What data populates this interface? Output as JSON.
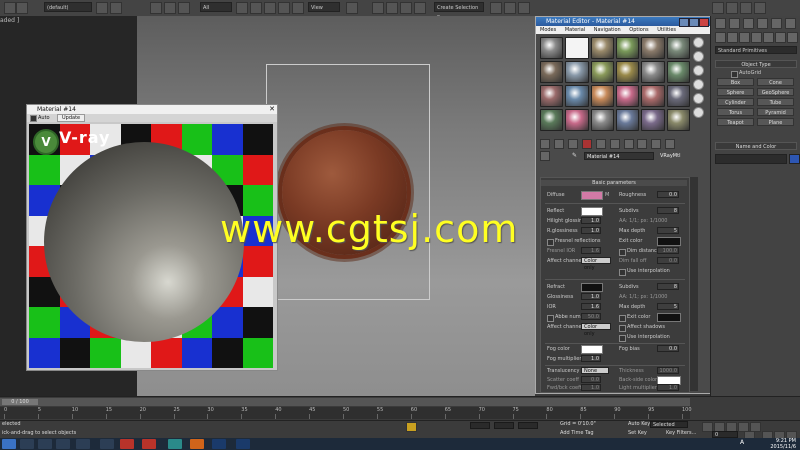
{
  "toolbar": {
    "undo_drop": "(default)",
    "filter_drop": "All",
    "view_drop": "View",
    "selection_set": "Create Selection Se"
  },
  "left_panel": {
    "label": "aded ]"
  },
  "watermark": "www.cgtsj.com",
  "preview_window": {
    "title": "Material #14",
    "auto_label": "Auto",
    "update_label": "Update",
    "logo_text": "V-ray",
    "close_glyph": "✕"
  },
  "material_editor": {
    "title": "Material Editor - Material #14",
    "menu": [
      "Modes",
      "Material",
      "Navigation",
      "Options",
      "Utilities"
    ],
    "material_name": "Material #14",
    "material_type": "VRayMtl",
    "rollout_title": "Basic parameters",
    "params": {
      "diffuse_label": "Diffuse",
      "roughness_label": "Roughness",
      "roughness_value": "0.0",
      "reflect_label": "Reflect",
      "subdivs_label": "Subdivs",
      "subdivs_value": "8",
      "hilight_label": "Hilight glossiness",
      "hilight_value": "1.0",
      "aa_label": "AA: 1/1; px: 1/1000",
      "rglossiness_label": "R.glossiness",
      "rglossiness_value": "1.0",
      "max_depth_label": "Max depth",
      "max_depth_value": "5",
      "fresnel_label": "Fresnel reflections",
      "exit_color_label": "Exit color",
      "fresnel_ior_label": "Fresnel IOR",
      "fresnel_ior_value": "1.6",
      "dim_distance_label": "Dim distance",
      "dim_distance_value": "100.0",
      "affect_channels_label": "Affect channels",
      "affect_channels_value": "Color only",
      "dim_falloff_label": "Dim fall off",
      "dim_falloff_value": "0.0",
      "use_interp_label": "Use interpolation",
      "refract_label": "Refract",
      "refract_subdivs_label": "Subdivs",
      "refract_subdivs_value": "8",
      "glossiness_label": "Glossiness",
      "glossiness_value": "1.0",
      "refract_aa_label": "AA: 1/1; px: 1/1000",
      "ior_label": "IOR",
      "ior_value": "1.6",
      "refract_maxdepth_label": "Max depth",
      "refract_maxdepth_value": "5",
      "abbe_label": "Abbe number",
      "abbe_value": "50.0",
      "refract_exit_label": "Exit color",
      "refract_affect_label": "Affect channels",
      "refract_affect_value": "Color only",
      "affect_shadows_label": "Affect shadows",
      "refract_use_interp_label": "Use interpolation",
      "fog_color_label": "Fog color",
      "fog_bias_label": "Fog bias",
      "fog_bias_value": "0.0",
      "fog_mult_label": "Fog multiplier",
      "fog_mult_value": "1.0",
      "translucency_label": "Translucency",
      "translucency_value": "None",
      "thickness_label": "Thickness",
      "thickness_value": "1000.0",
      "scatter_label": "Scatter coeff",
      "scatter_value": "0.0",
      "backside_label": "Back-side color",
      "fwdbck_label": "Fwd/bck coeff",
      "fwdbck_value": "1.0",
      "light_mult_label": "Light multiplier",
      "light_mult_value": "1.0"
    }
  },
  "command_panel": {
    "dropdown": "Standard Primitives",
    "object_type": "Object Type",
    "autogrid": "AutoGrid",
    "buttons": [
      "Box",
      "Cone",
      "Sphere",
      "GeoSphere",
      "Cylinder",
      "Tube",
      "Torus",
      "Pyramid",
      "Teapot",
      "Plane"
    ],
    "name_and_color": "Name and Color"
  },
  "timeline": {
    "frame_counter": "0 / 100",
    "ticks": [
      "0",
      "5",
      "10",
      "15",
      "20",
      "25",
      "30",
      "35",
      "40",
      "45",
      "50",
      "55",
      "60",
      "65",
      "70",
      "75",
      "80",
      "85",
      "90",
      "95",
      "100"
    ]
  },
  "statusbar": {
    "selected": "elected",
    "prompt": "ick-and-drag to select objects",
    "grid": "Grid = 0'10.0\"",
    "add_time_tag": "Add Time Tag",
    "auto_key": "Auto Key",
    "selected_drop": "Selected",
    "set_key": "Set Key",
    "key_filters": "Key Filters...",
    "frame": "0"
  },
  "taskbar": {
    "time": "9:21 PM",
    "date": "2015/11/6",
    "tray_letter": "A"
  },
  "colors": {
    "diffuse": "#d27aa6",
    "reflect": "#ffffff",
    "refract": "#101010",
    "fog": "#ffffff",
    "backside": "#ffffff",
    "exit": "#111111",
    "accent_blue": "#2b5a9e"
  }
}
